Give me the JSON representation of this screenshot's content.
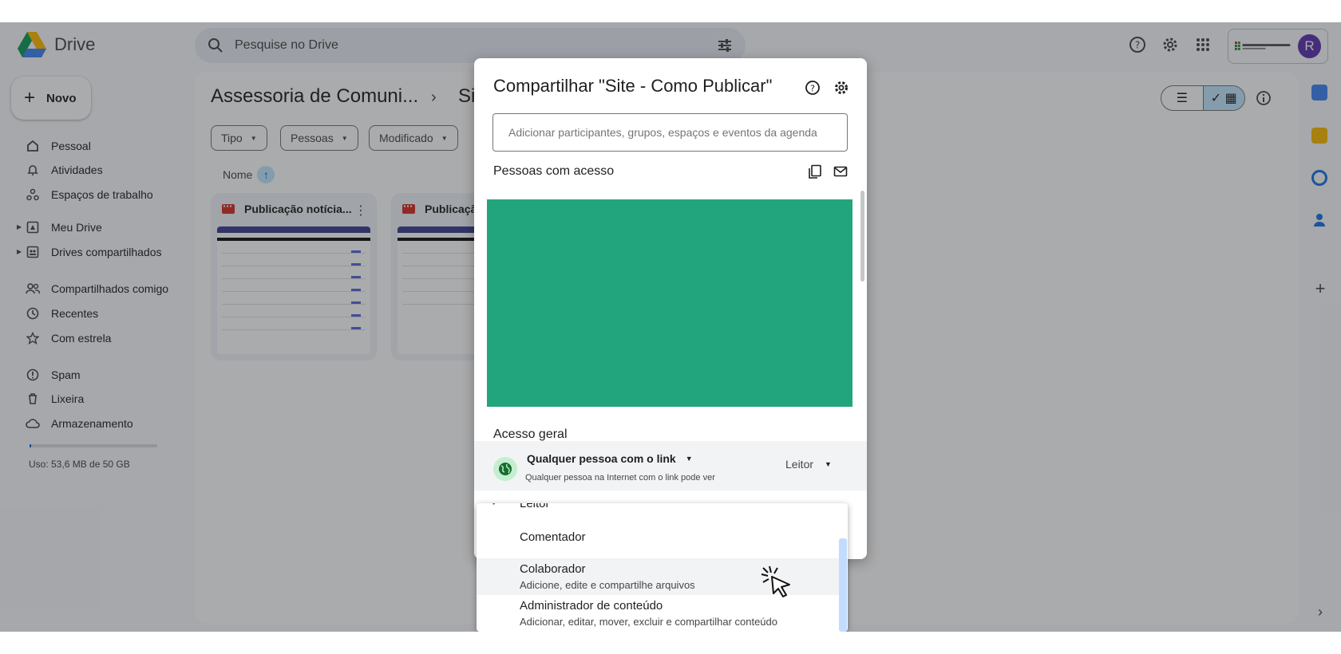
{
  "header": {
    "app_name": "Drive",
    "search_placeholder": "Pesquise no Drive"
  },
  "sidebar": {
    "new_label": "Novo",
    "items": [
      {
        "label": "Pessoal"
      },
      {
        "label": "Atividades"
      },
      {
        "label": "Espaços de trabalho"
      },
      {
        "label": "Meu Drive"
      },
      {
        "label": "Drives compartilhados"
      },
      {
        "label": "Compartilhados comigo"
      },
      {
        "label": "Recentes"
      },
      {
        "label": "Com estrela"
      },
      {
        "label": "Spam"
      },
      {
        "label": "Lixeira"
      },
      {
        "label": "Armazenamento"
      }
    ],
    "storage_text": "Uso: 53,6 MB de 50 GB",
    "storage_fraction": 0.001
  },
  "main": {
    "breadcrumb": "Assessoria de Comuni...",
    "breadcrumb_current": "Sit",
    "filters": [
      "Tipo",
      "Pessoas",
      "Modificado"
    ],
    "sort_label": "Nome",
    "files": [
      {
        "name": "Publicação notícia...",
        "icon": "video-file-icon"
      },
      {
        "name": "Publicação",
        "icon": "video-file-icon"
      }
    ]
  },
  "dialog": {
    "title": "Compartilhar \"Site - Como Publicar\"",
    "add_placeholder": "Adicionar participantes, grupos, espaços e eventos da agenda",
    "people_heading": "Pessoas com acesso",
    "general_heading": "Acesso geral",
    "general_access_title": "Qualquer pessoa com o link",
    "general_access_desc": "Qualquer pessoa na Internet com o link pode ver",
    "role_label": "Leitor"
  },
  "role_menu": {
    "items": [
      {
        "label": "Leitor",
        "desc": "",
        "selected": true
      },
      {
        "label": "Comentador",
        "desc": ""
      },
      {
        "label": "Colaborador",
        "desc": "Adicione, edite e compartilhe arquivos",
        "hovered": true
      },
      {
        "label": "Administrador de conteúdo",
        "desc": "Adicionar, editar, mover, excluir e compartilhar conteúdo"
      }
    ]
  },
  "colors": {
    "accent": "#0b57d0",
    "redacted": "#22a57c",
    "avatar": "#5e35b1"
  },
  "avatar_letter": "R"
}
